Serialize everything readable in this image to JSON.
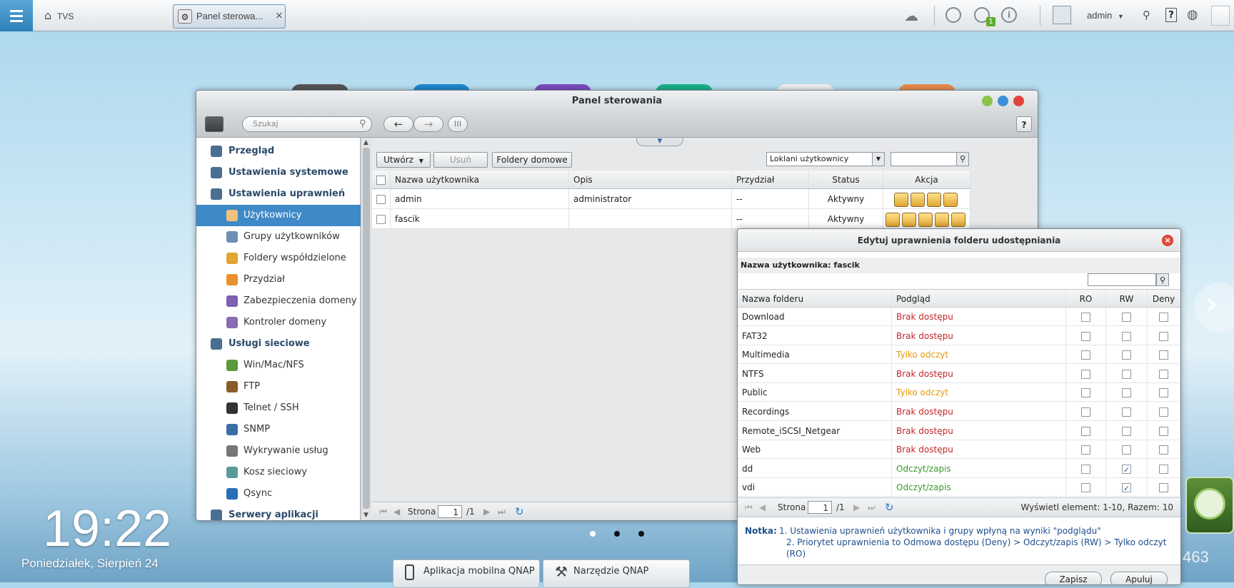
{
  "topbar": {
    "home_label": "TVS",
    "tab_label": "Panel sterowa...",
    "tab_close": "×",
    "user": "admin",
    "user_caret": "▼",
    "notify_badge": "1"
  },
  "desktop": {
    "clock": "19:22",
    "date": "Poniedziałek, Sierpień 24",
    "taskbar": [
      "Aplikacja mobilna QNAP",
      "Narzędzie QNAP"
    ],
    "right_number": "463",
    "next_arrow": "›"
  },
  "window": {
    "title": "Panel sterowania",
    "search_placeholder": "Szukaj",
    "help": "?",
    "sidebar": [
      {
        "label": "Przegląd",
        "type": "head",
        "icon": "overview-icon"
      },
      {
        "label": "Ustawienia systemowe",
        "type": "head",
        "icon": "gear-icon"
      },
      {
        "label": "Ustawienia uprawnień",
        "type": "head",
        "icon": "user-icon"
      },
      {
        "label": "Użytkownicy",
        "type": "sub",
        "icon": "user-icon",
        "selected": true
      },
      {
        "label": "Grupy użytkowników",
        "type": "sub",
        "icon": "group-icon"
      },
      {
        "label": "Foldery współdzielone",
        "type": "sub",
        "icon": "folder-icon"
      },
      {
        "label": "Przydział",
        "type": "sub",
        "icon": "quota-icon"
      },
      {
        "label": "Zabezpieczenia domeny",
        "type": "sub",
        "icon": "domain-security-icon"
      },
      {
        "label": "Kontroler domeny",
        "type": "sub",
        "icon": "domain-controller-icon"
      },
      {
        "label": "Usługi sieciowe",
        "type": "head",
        "icon": "network-icon"
      },
      {
        "label": "Win/Mac/NFS",
        "type": "sub",
        "icon": "winmac-icon"
      },
      {
        "label": "FTP",
        "type": "sub",
        "icon": "ftp-icon"
      },
      {
        "label": "Telnet / SSH",
        "type": "sub",
        "icon": "terminal-icon"
      },
      {
        "label": "SNMP",
        "type": "sub",
        "icon": "snmp-icon"
      },
      {
        "label": "Wykrywanie usług",
        "type": "sub",
        "icon": "discovery-icon"
      },
      {
        "label": "Kosz sieciowy",
        "type": "sub",
        "icon": "recycle-icon"
      },
      {
        "label": "Qsync",
        "type": "sub",
        "icon": "qsync-icon"
      },
      {
        "label": "Serwery aplikacji",
        "type": "head",
        "icon": "server-icon"
      }
    ],
    "toolbar": {
      "create": "Utwórz",
      "delete": "Usuń",
      "home_folders": "Foldery domowe",
      "filter": "Loklani użytkownicy"
    },
    "users_table": {
      "columns": [
        "Nazwa użytkownika",
        "Opis",
        "Przydział",
        "Status",
        "Akcja"
      ],
      "rows": [
        {
          "name": "admin",
          "desc": "administrator",
          "quota": "--",
          "status": "Aktywny"
        },
        {
          "name": "fascik",
          "desc": "",
          "quota": "--",
          "status": "Aktywny"
        }
      ]
    },
    "pager": {
      "label": "Strona",
      "page": "1",
      "total": "/1"
    }
  },
  "dialog": {
    "title": "Edytuj uprawnienia folderu udostępniania",
    "user_label": "Nazwa użytkownika: fascik",
    "columns": [
      "Nazwa folderu",
      "Podgląd",
      "RO",
      "RW",
      "Deny"
    ],
    "rows": [
      {
        "folder": "Download",
        "preview": "Brak dostępu",
        "ro": false,
        "rw": false,
        "deny": false,
        "color": "#c0282d"
      },
      {
        "folder": "FAT32",
        "preview": "Brak dostępu",
        "ro": false,
        "rw": false,
        "deny": false,
        "color": "#c0282d"
      },
      {
        "folder": "Multimedia",
        "preview": "Tylko odczyt",
        "ro": false,
        "rw": false,
        "deny": false,
        "color": "#e39a12"
      },
      {
        "folder": "NTFS",
        "preview": "Brak dostępu",
        "ro": false,
        "rw": false,
        "deny": false,
        "color": "#c0282d"
      },
      {
        "folder": "Public",
        "preview": "Tylko odczyt",
        "ro": false,
        "rw": false,
        "deny": false,
        "color": "#e39a12"
      },
      {
        "folder": "Recordings",
        "preview": "Brak dostępu",
        "ro": false,
        "rw": false,
        "deny": false,
        "color": "#c0282d"
      },
      {
        "folder": "Remote_iSCSI_Netgear",
        "preview": "Brak dostępu",
        "ro": false,
        "rw": false,
        "deny": false,
        "color": "#c0282d"
      },
      {
        "folder": "Web",
        "preview": "Brak dostępu",
        "ro": false,
        "rw": false,
        "deny": false,
        "color": "#c0282d"
      },
      {
        "folder": "dd",
        "preview": "Odczyt/zapis",
        "ro": false,
        "rw": true,
        "deny": false,
        "color": "#3a9a2c"
      },
      {
        "folder": "vdi",
        "preview": "Odczyt/zapis",
        "ro": false,
        "rw": true,
        "deny": false,
        "color": "#3a9a2c"
      }
    ],
    "pager": {
      "label": "Strona",
      "page": "1",
      "total": "/1",
      "summary": "Wyświetl element: 1-10, Razem: 10"
    },
    "note_label": "Notka:",
    "note_lines": [
      "1. Ustawienia uprawnień użytkownika i grupy wpłyną na wyniki \"podglądu\"",
      "2. Priorytet uprawnienia to Odmowa dostępu (Deny) > Odczyt/zapis (RW) > Tylko odczyt",
      "(RO)"
    ],
    "save": "Zapisz",
    "apply": "Apuluj"
  }
}
